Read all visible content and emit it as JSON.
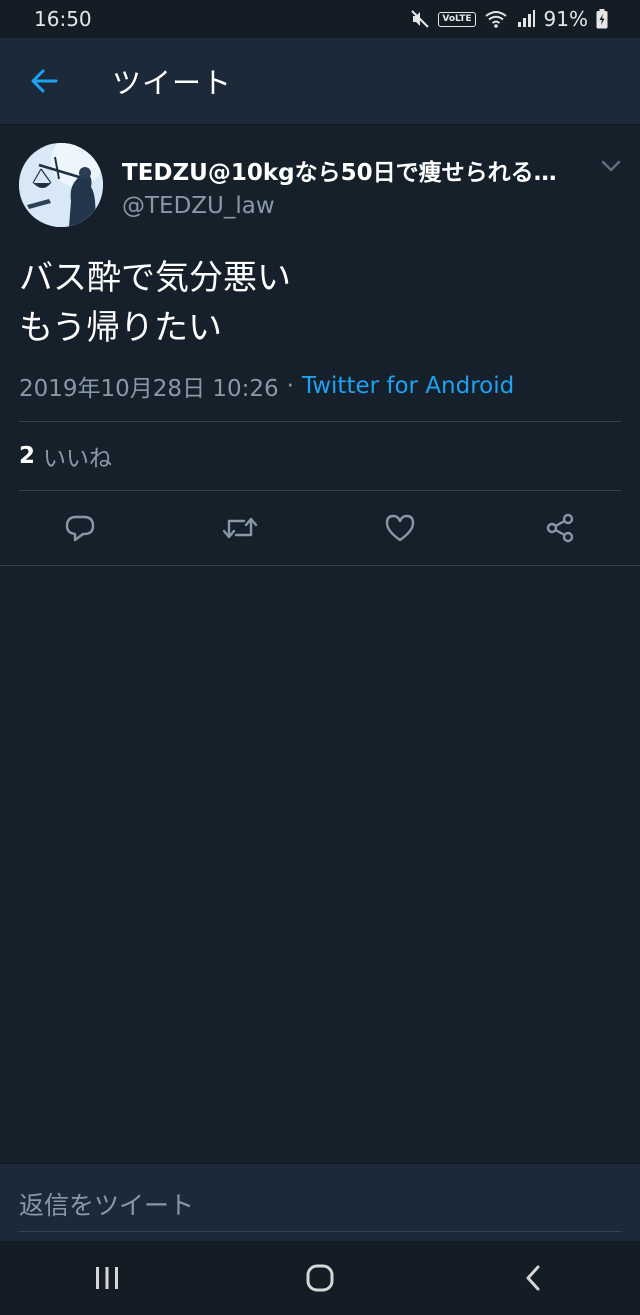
{
  "status_bar": {
    "time": "16:50",
    "volte": "VoLTE",
    "battery": "91%"
  },
  "header": {
    "title": "ツイート",
    "back_icon": "arrow-left-icon"
  },
  "tweet": {
    "display_name": "TEDZU@10kgなら50日で痩せられる…",
    "handle": "@TEDZU_law",
    "text_line1": "バス酔で気分悪い",
    "text_line2": "もう帰りたい",
    "timestamp": "2019年10月28日 10:26",
    "separator": "·",
    "source": "Twitter for Android",
    "likes_count": "2",
    "likes_label": "いいね"
  },
  "actions": [
    {
      "name": "reply",
      "icon": "comment-icon"
    },
    {
      "name": "retweet",
      "icon": "retweet-icon"
    },
    {
      "name": "like",
      "icon": "heart-icon"
    },
    {
      "name": "share",
      "icon": "share-icon"
    }
  ],
  "reply_bar": {
    "placeholder": "返信をツイート"
  },
  "colors": {
    "background": "#15202b",
    "header": "#1c2938",
    "accent": "#1da1f2",
    "secondary_text": "#8899a6",
    "divider": "#38444d"
  }
}
